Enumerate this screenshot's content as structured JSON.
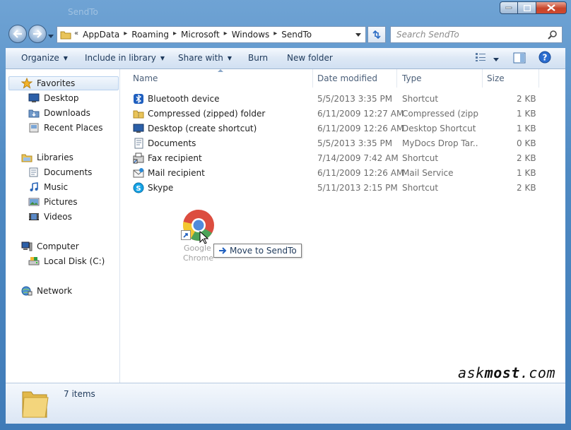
{
  "window": {
    "title": "SendTo"
  },
  "nav": {
    "crumbs": [
      "AppData",
      "Roaming",
      "Microsoft",
      "Windows",
      "SendTo"
    ],
    "overflow_marker": "«",
    "search_placeholder": "Search SendTo"
  },
  "toolbar": {
    "organize": "Organize",
    "include": "Include in library",
    "share": "Share with",
    "burn": "Burn",
    "new_folder": "New folder"
  },
  "sidebar": {
    "favorites": "Favorites",
    "desktop": "Desktop",
    "downloads": "Downloads",
    "recent": "Recent Places",
    "libraries": "Libraries",
    "documents": "Documents",
    "music": "Music",
    "pictures": "Pictures",
    "videos": "Videos",
    "computer": "Computer",
    "local_disk": "Local Disk (C:)",
    "network": "Network"
  },
  "columns": {
    "name": "Name",
    "date": "Date modified",
    "type": "Type",
    "size": "Size"
  },
  "files": [
    {
      "name": "Bluetooth device",
      "date": "5/5/2013 3:35 PM",
      "type": "Shortcut",
      "size": "2 KB",
      "icon": "bluetooth-icon"
    },
    {
      "name": "Compressed (zipped) folder",
      "date": "6/11/2009 12:27 AM",
      "type": "Compressed (zipp...",
      "size": "1 KB",
      "icon": "zip-folder-icon"
    },
    {
      "name": "Desktop (create shortcut)",
      "date": "6/11/2009 12:26 AM",
      "type": "Desktop Shortcut",
      "size": "1 KB",
      "icon": "desktop-icon"
    },
    {
      "name": "Documents",
      "date": "5/5/2013 3:35 PM",
      "type": "MyDocs Drop Tar...",
      "size": "0 KB",
      "icon": "documents-icon"
    },
    {
      "name": "Fax recipient",
      "date": "7/14/2009 7:42 AM",
      "type": "Shortcut",
      "size": "2 KB",
      "icon": "fax-icon"
    },
    {
      "name": "Mail recipient",
      "date": "6/11/2009 12:26 AM",
      "type": "Mail Service",
      "size": "1 KB",
      "icon": "mail-icon"
    },
    {
      "name": "Skype",
      "date": "5/11/2013 2:15 PM",
      "type": "Shortcut",
      "size": "2 KB",
      "icon": "skype-icon"
    }
  ],
  "drag": {
    "label_line1": "Google",
    "label_line2": "Chrome",
    "tooltip": "Move to SendTo"
  },
  "status": {
    "items": "7 items"
  },
  "watermark": {
    "part1": "ask",
    "part2": "most",
    "part3": ".com"
  },
  "colors": {
    "frame": "#4f8ac3",
    "selection": "#dbe8f6",
    "link_text": "#1e395b"
  }
}
